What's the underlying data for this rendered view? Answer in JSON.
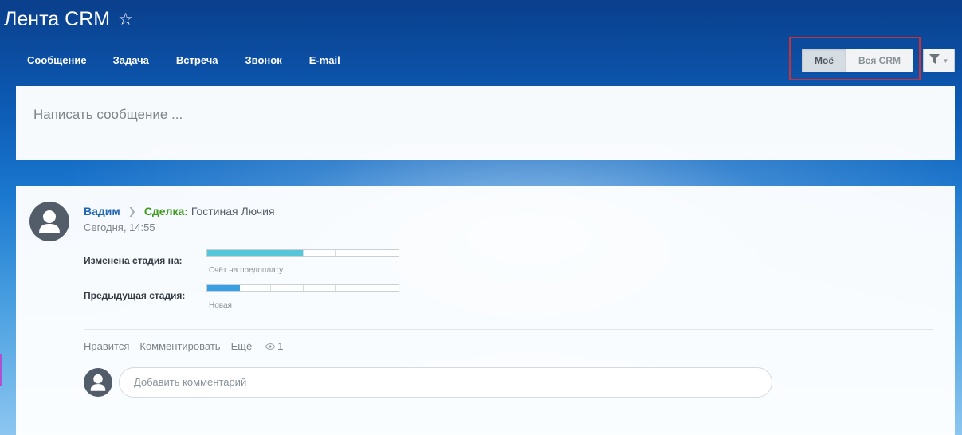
{
  "header": {
    "title": "Лента CRM",
    "favorite_icon": "star-outline-icon"
  },
  "toolbar": {
    "items": [
      "Сообщение",
      "Задача",
      "Встреча",
      "Звонок",
      "E-mail"
    ]
  },
  "scope_switch": {
    "mine_label": "Моё",
    "all_label": "Вся CRM",
    "selected": "Моё"
  },
  "filter": {
    "icon": "filter-icon"
  },
  "composer": {
    "placeholder": "Написать сообщение ..."
  },
  "post": {
    "author": "Вадим",
    "deal_label": "Сделка:",
    "deal_name": "Гостиная Лючия",
    "time": "Сегодня, 14:55",
    "changed_stage_label": "Изменена стадия на:",
    "changed_stage_name": "Счёт на предоплату",
    "changed_stage_progress": 0.5,
    "changed_stage_color": "#55c7d8",
    "previous_stage_label": "Предыдущая стадия:",
    "previous_stage_name": "Новая",
    "previous_stage_progress": 0.17,
    "previous_stage_color": "#3aa0e6",
    "actions": {
      "like": "Нравится",
      "comment": "Комментировать",
      "more": "Ещё",
      "views": "1"
    },
    "comment_placeholder": "Добавить комментарий"
  },
  "colors": {
    "link_blue": "#2067b0",
    "deal_green": "#3e9b1b",
    "highlight_red": "#c4333b"
  }
}
